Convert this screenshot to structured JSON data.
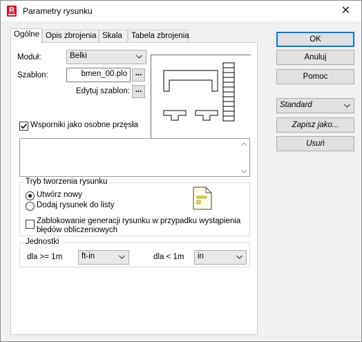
{
  "window": {
    "title": "Parametry rysunku",
    "close_glyph": "✕",
    "app_icon_letter": "R"
  },
  "tabs": [
    {
      "label": "Ogólne",
      "active": true
    },
    {
      "label": "Opis zbrojenia",
      "active": false
    },
    {
      "label": "Skala",
      "active": false
    },
    {
      "label": "Tabela zbrojenia",
      "active": false
    }
  ],
  "general": {
    "modul_label": "Moduł:",
    "modul_value": "Belki",
    "szablon_label": "Szablon:",
    "szablon_value": "bmen_00.plo",
    "browse_glyph": "...",
    "edytuj_label": "Edytuj szablon:",
    "edytuj_glyph": "...",
    "wsporniki_label": "Wsporniki jako osobne przęsła",
    "wsporniki_checked": true,
    "memo_text": ""
  },
  "tryb": {
    "title": "Tryb tworzenia rysunku",
    "option_new": "Utwórz nowy",
    "option_add": "Dodaj rysunek do listy",
    "selected": "Utwórz nowy",
    "block_label": "Zablokowanie generacji rysunku w przypadku wystąpienia błędów obliczeniowych",
    "block_checked": false
  },
  "jednostki": {
    "title": "Jednostki",
    "ge_label": "dla >= 1m",
    "ge_value": "ft-in",
    "lt_label": "dla < 1m",
    "lt_value": "in"
  },
  "buttons": {
    "ok": "OK",
    "cancel": "Anuluj",
    "help": "Pomoc",
    "preset_value": "Standard",
    "save_as": "Zapisz jako...",
    "delete": "Usuń"
  },
  "colors": {
    "accent": "#0078d7",
    "app_icon": "#d9182d",
    "template_icon": "#e8d44a"
  }
}
